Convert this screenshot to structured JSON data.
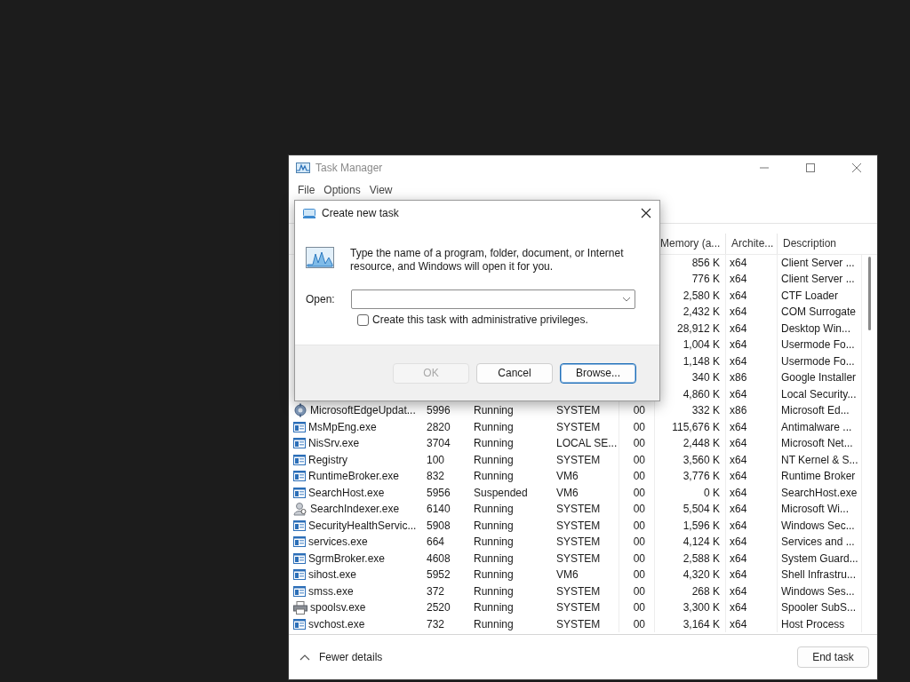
{
  "window": {
    "title": "Task Manager",
    "menu": [
      "File",
      "Options",
      "View"
    ]
  },
  "table": {
    "columns": [
      "Memory (a...",
      "Archite...",
      "Description"
    ],
    "rows": [
      {
        "memory": "856 K",
        "architecture": "x64",
        "description": "Client Server ..."
      },
      {
        "memory": "776 K",
        "architecture": "x64",
        "description": "Client Server ..."
      },
      {
        "memory": "2,580 K",
        "architecture": "x64",
        "description": "CTF Loader"
      },
      {
        "memory": "2,432 K",
        "architecture": "x64",
        "description": "COM Surrogate"
      },
      {
        "memory": "28,912 K",
        "architecture": "x64",
        "description": "Desktop Win..."
      },
      {
        "memory": "1,004 K",
        "architecture": "x64",
        "description": "Usermode Fo..."
      },
      {
        "memory": "1,148 K",
        "architecture": "x64",
        "description": "Usermode Fo..."
      },
      {
        "memory": "340 K",
        "architecture": "x86",
        "description": "Google Installer"
      },
      {
        "memory": "4,860 K",
        "architecture": "x64",
        "description": "Local Security..."
      },
      {
        "kind": "updater",
        "name": "MicrosoftEdgeUpdat...",
        "pid": "5996",
        "status": "Running",
        "user": "SYSTEM",
        "cpu": "00",
        "memory": "332 K",
        "architecture": "x86",
        "description": "Microsoft Ed..."
      },
      {
        "kind": "app",
        "name": "MsMpEng.exe",
        "pid": "2820",
        "status": "Running",
        "user": "SYSTEM",
        "cpu": "00",
        "memory": "115,676 K",
        "architecture": "x64",
        "description": "Antimalware ..."
      },
      {
        "kind": "app",
        "name": "NisSrv.exe",
        "pid": "3704",
        "status": "Running",
        "user": "LOCAL SE...",
        "cpu": "00",
        "memory": "2,448 K",
        "architecture": "x64",
        "description": "Microsoft Net..."
      },
      {
        "kind": "app",
        "name": "Registry",
        "pid": "100",
        "status": "Running",
        "user": "SYSTEM",
        "cpu": "00",
        "memory": "3,560 K",
        "architecture": "x64",
        "description": "NT Kernel & S..."
      },
      {
        "kind": "app",
        "name": "RuntimeBroker.exe",
        "pid": "832",
        "status": "Running",
        "user": "VM6",
        "cpu": "00",
        "memory": "3,776 K",
        "architecture": "x64",
        "description": "Runtime Broker"
      },
      {
        "kind": "app",
        "name": "SearchHost.exe",
        "pid": "5956",
        "status": "Suspended",
        "user": "VM6",
        "cpu": "00",
        "memory": "0 K",
        "architecture": "x64",
        "description": "SearchHost.exe"
      },
      {
        "kind": "indexer",
        "name": "SearchIndexer.exe",
        "pid": "6140",
        "status": "Running",
        "user": "SYSTEM",
        "cpu": "00",
        "memory": "5,504 K",
        "architecture": "x64",
        "description": "Microsoft Wi..."
      },
      {
        "kind": "app",
        "name": "SecurityHealthServic...",
        "pid": "5908",
        "status": "Running",
        "user": "SYSTEM",
        "cpu": "00",
        "memory": "1,596 K",
        "architecture": "x64",
        "description": "Windows Sec..."
      },
      {
        "kind": "app",
        "name": "services.exe",
        "pid": "664",
        "status": "Running",
        "user": "SYSTEM",
        "cpu": "00",
        "memory": "4,124 K",
        "architecture": "x64",
        "description": "Services and ..."
      },
      {
        "kind": "app",
        "name": "SgrmBroker.exe",
        "pid": "4608",
        "status": "Running",
        "user": "SYSTEM",
        "cpu": "00",
        "memory": "2,588 K",
        "architecture": "x64",
        "description": "System Guard..."
      },
      {
        "kind": "app",
        "name": "sihost.exe",
        "pid": "5952",
        "status": "Running",
        "user": "VM6",
        "cpu": "00",
        "memory": "4,320 K",
        "architecture": "x64",
        "description": "Shell Infrastru..."
      },
      {
        "kind": "app",
        "name": "smss.exe",
        "pid": "372",
        "status": "Running",
        "user": "SYSTEM",
        "cpu": "00",
        "memory": "268 K",
        "architecture": "x64",
        "description": "Windows Ses..."
      },
      {
        "kind": "printer",
        "name": "spoolsv.exe",
        "pid": "2520",
        "status": "Running",
        "user": "SYSTEM",
        "cpu": "00",
        "memory": "3,300 K",
        "architecture": "x64",
        "description": "Spooler SubS..."
      },
      {
        "kind": "app",
        "name": "svchost.exe",
        "pid": "732",
        "status": "Running",
        "user": "SYSTEM",
        "cpu": "00",
        "memory": "3,164 K",
        "architecture": "x64",
        "description": "Host Process"
      }
    ]
  },
  "footer": {
    "toggle": "Fewer details",
    "button": "End task"
  },
  "dialog": {
    "title": "Create new task",
    "message": "Type the name of a program, folder, document, or Internet resource, and Windows will open it for you.",
    "open_label": "Open:",
    "checkbox": {
      "label": "Create this task with administrative privileges.",
      "checked": false
    },
    "buttons": [
      {
        "label": "OK",
        "disabled": true,
        "focused": false
      },
      {
        "label": "Cancel",
        "disabled": false,
        "focused": false
      },
      {
        "label": "Browse...",
        "disabled": false,
        "focused": true
      }
    ]
  }
}
